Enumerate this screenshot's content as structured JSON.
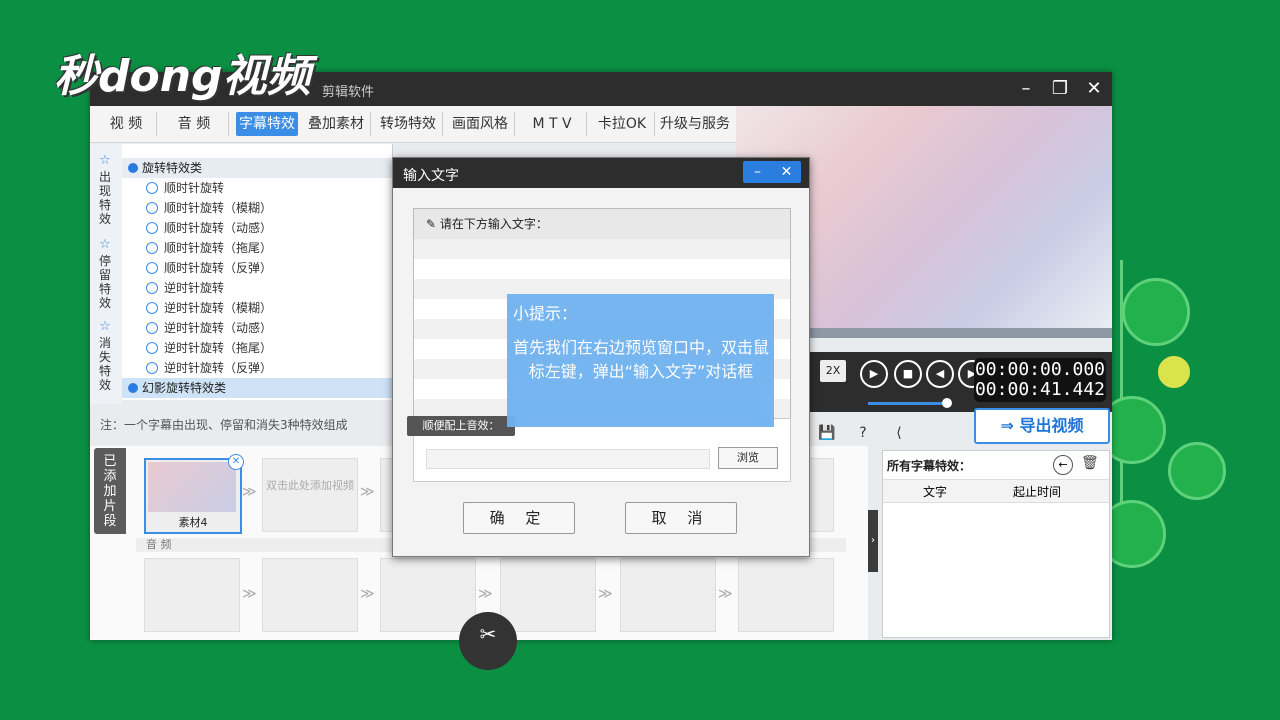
{
  "logo_text": "秒dong视频",
  "window": {
    "title": "剪辑软件",
    "min_icon": "minimize-icon",
    "max_icon": "maximize-icon",
    "close_icon": "close-icon"
  },
  "tabs": [
    "视 频",
    "音 频",
    "字幕特效",
    "叠加素材",
    "转场特效",
    "画面风格",
    "M T V",
    "卡拉OK",
    "升级与服务"
  ],
  "active_tab": "字幕特效",
  "categories": [
    "出现特效",
    "停留特效",
    "消失特效"
  ],
  "effects": {
    "group1": "旋转特效类",
    "items": [
      "顺时针旋转",
      "顺时针旋转（模糊）",
      "顺时针旋转（动感）",
      "顺时针旋转（拖尾）",
      "顺时针旋转（反弹）",
      "逆时针旋转",
      "逆时针旋转（模糊）",
      "逆时针旋转（动感）",
      "逆时针旋转（拖尾）",
      "逆时针旋转（反弹）"
    ],
    "group2": "幻影旋转特效类"
  },
  "note": "注：一个字幕由出现、停留和消失3种特效组成",
  "player": {
    "speed": "2X",
    "time_current": "00:00:00.000",
    "time_total": "00:00:41.442"
  },
  "export_label": "导出视频",
  "timeline": {
    "added_tab": "已添加片段",
    "clip_name": "素材4",
    "placeholder": "双击此处添加视频",
    "audio_label": "音 频"
  },
  "right_panel": {
    "title": "所有字幕特效：",
    "col_text": "文字",
    "col_time": "起止时间"
  },
  "dialog": {
    "title": "输入文字",
    "prompt": "请在下方输入文字：",
    "sound_label": "顺便配上音效：",
    "browse": "浏览",
    "ok": "确 定",
    "cancel": "取 消"
  },
  "tip": {
    "heading": "小提示：",
    "body": "首先我们在右边预览窗口中，双击鼠标左键，弹出“输入文字”对话框"
  }
}
